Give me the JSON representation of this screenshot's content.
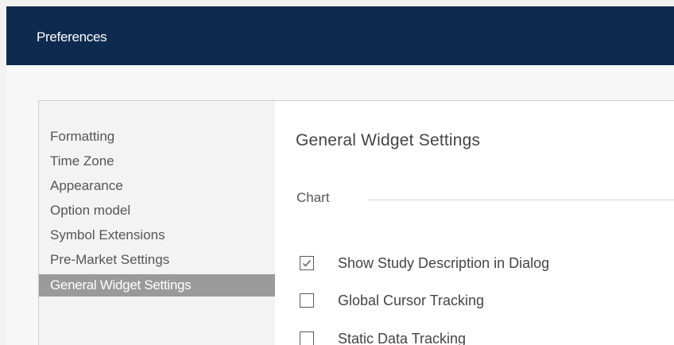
{
  "dialog": {
    "title": "Preferences"
  },
  "sidebar": {
    "items": [
      {
        "label": "Formatting",
        "active": false
      },
      {
        "label": "Time Zone",
        "active": false
      },
      {
        "label": "Appearance",
        "active": false
      },
      {
        "label": "Option model",
        "active": false
      },
      {
        "label": "Symbol Extensions",
        "active": false
      },
      {
        "label": "Pre-Market Settings",
        "active": false
      },
      {
        "label": "General Widget Settings",
        "active": true
      }
    ]
  },
  "content": {
    "heading": "General Widget Settings",
    "group_label": "Chart",
    "options": [
      {
        "label": "Show Study Description in Dialog",
        "checked": true
      },
      {
        "label": "Global Cursor Tracking",
        "checked": false
      },
      {
        "label": "Static Data Tracking",
        "checked": false
      }
    ]
  },
  "colors": {
    "titlebar": "#0e2a4f",
    "active_item": "#9a9a9a"
  }
}
